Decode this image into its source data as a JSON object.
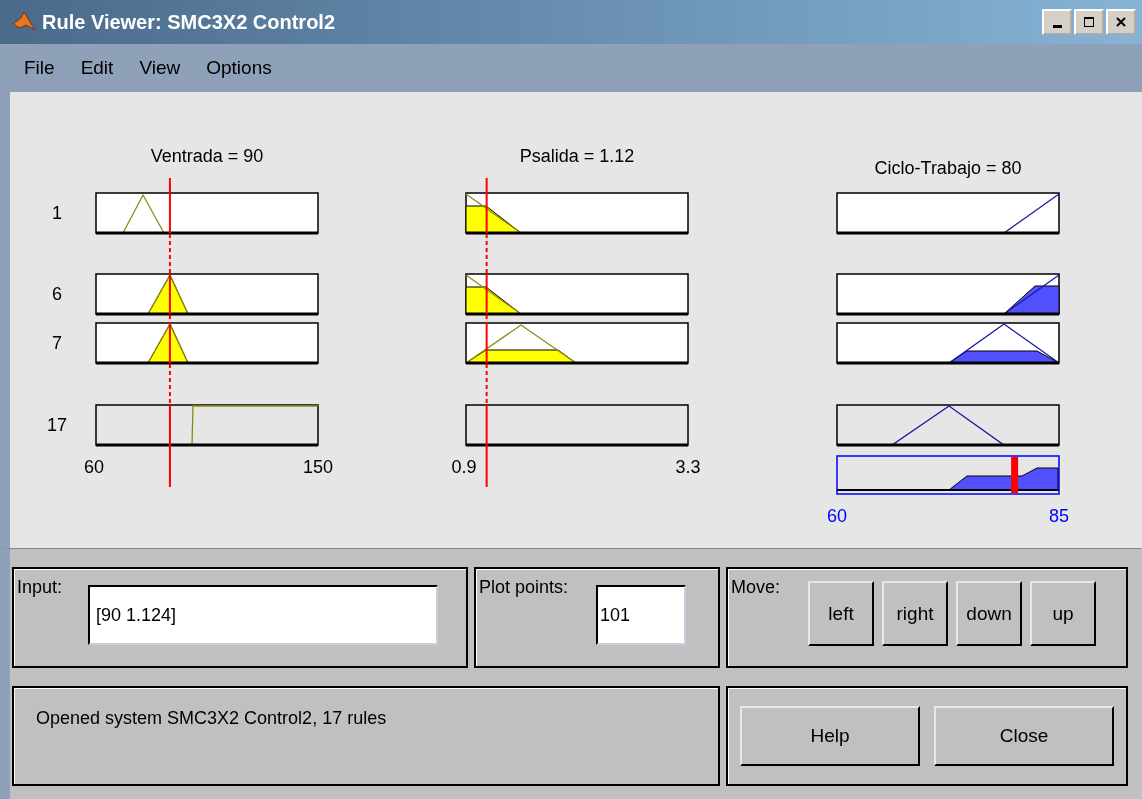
{
  "window": {
    "title": "Rule Viewer: SMC3X2 Control2"
  },
  "menu": [
    "File",
    "Edit",
    "View",
    "Options"
  ],
  "rules": [
    {
      "label": "1",
      "active": true
    },
    {
      "label": "6",
      "active": true
    },
    {
      "label": "7",
      "active": true
    },
    {
      "label": "17",
      "active": false
    }
  ],
  "inputs": [
    {
      "title": "Ventrada = 90",
      "min": "60",
      "max": "150"
    },
    {
      "title": "Psalida = 1.12",
      "min": "0.9",
      "max": "3.3"
    }
  ],
  "output": {
    "title": "Ciclo-Trabajo = 80",
    "min": "60",
    "max": "85",
    "level": 0.8
  },
  "input_field": {
    "label": "Input:",
    "value": "[90 1.124]"
  },
  "plot_points": {
    "label": "Plot points:",
    "value": "101"
  },
  "move": {
    "label": "Move:",
    "buttons": [
      "left",
      "right",
      "down",
      "up"
    ]
  },
  "status": "Opened system SMC3X2 Control2, 17 rules",
  "buttons": [
    "Help",
    "Close"
  ]
}
